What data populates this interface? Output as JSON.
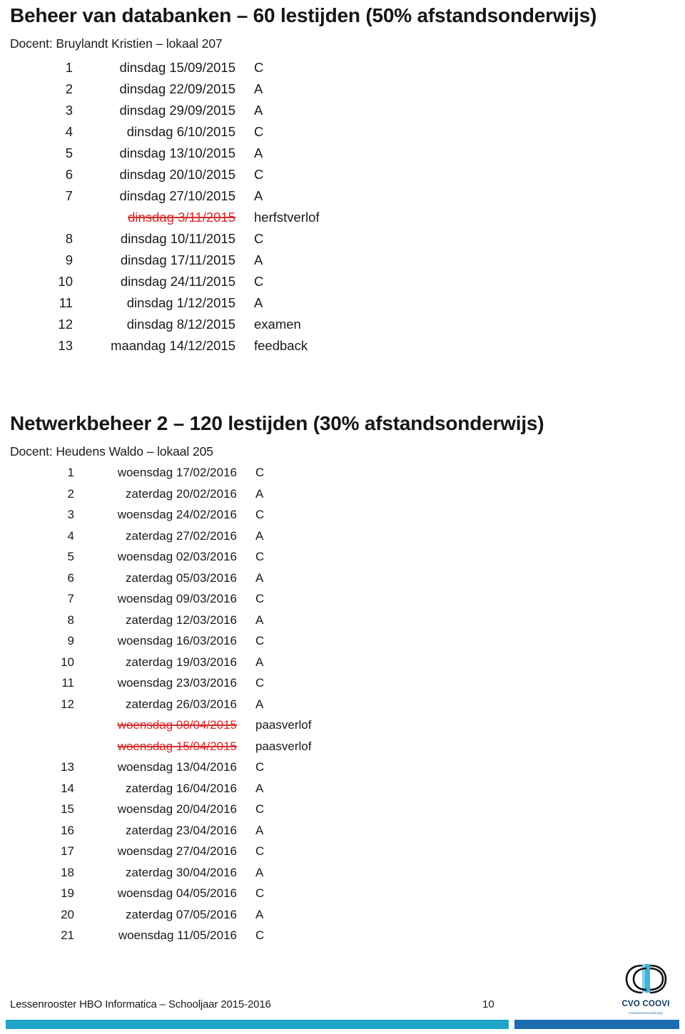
{
  "document": {
    "sections": [
      {
        "id": "section-1",
        "title": "Beheer van databanken – 60 lestijden (50% afstandsonderwijs)",
        "teacher": "Docent: Bruylandt Kristien – lokaal 207",
        "rows": [
          {
            "num": "1",
            "date": "dinsdag 15/09/2015",
            "code": "C",
            "cancelled": false
          },
          {
            "num": "2",
            "date": "dinsdag 22/09/2015",
            "code": "A",
            "cancelled": false
          },
          {
            "num": "3",
            "date": "dinsdag 29/09/2015",
            "code": "A",
            "cancelled": false
          },
          {
            "num": "4",
            "date": "dinsdag 6/10/2015",
            "code": "C",
            "cancelled": false
          },
          {
            "num": "5",
            "date": "dinsdag 13/10/2015",
            "code": "A",
            "cancelled": false
          },
          {
            "num": "6",
            "date": "dinsdag 20/10/2015",
            "code": "C",
            "cancelled": false
          },
          {
            "num": "7",
            "date": "dinsdag 27/10/2015",
            "code": "A",
            "cancelled": false
          },
          {
            "num": "",
            "date": "dinsdag 3/11/2015",
            "code": "herfstverlof",
            "cancelled": true
          },
          {
            "num": "8",
            "date": "dinsdag 10/11/2015",
            "code": "C",
            "cancelled": false
          },
          {
            "num": "9",
            "date": "dinsdag 17/11/2015",
            "code": "A",
            "cancelled": false
          },
          {
            "num": "10",
            "date": "dinsdag 24/11/2015",
            "code": "C",
            "cancelled": false
          },
          {
            "num": "11",
            "date": "dinsdag 1/12/2015",
            "code": "A",
            "cancelled": false
          },
          {
            "num": "12",
            "date": "dinsdag 8/12/2015",
            "code": "examen",
            "cancelled": false
          },
          {
            "num": "13",
            "date": "maandag 14/12/2015",
            "code": "feedback",
            "cancelled": false
          }
        ]
      },
      {
        "id": "section-2",
        "title": "Netwerkbeheer 2 – 120 lestijden (30% afstandsonderwijs)",
        "teacher": "Docent: Heudens Waldo – lokaal 205",
        "rows": [
          {
            "num": "1",
            "date": "woensdag 17/02/2016",
            "code": "C",
            "cancelled": false
          },
          {
            "num": "2",
            "date": "zaterdag 20/02/2016",
            "code": "A",
            "cancelled": false
          },
          {
            "num": "3",
            "date": "woensdag 24/02/2016",
            "code": "C",
            "cancelled": false
          },
          {
            "num": "4",
            "date": "zaterdag 27/02/2016",
            "code": "A",
            "cancelled": false
          },
          {
            "num": "5",
            "date": "woensdag 02/03/2016",
            "code": "C",
            "cancelled": false
          },
          {
            "num": "6",
            "date": "zaterdag 05/03/2016",
            "code": "A",
            "cancelled": false
          },
          {
            "num": "7",
            "date": "woensdag 09/03/2016",
            "code": "C",
            "cancelled": false
          },
          {
            "num": "8",
            "date": "zaterdag 12/03/2016",
            "code": "A",
            "cancelled": false
          },
          {
            "num": "9",
            "date": "woensdag 16/03/2016",
            "code": "C",
            "cancelled": false
          },
          {
            "num": "10",
            "date": "zaterdag 19/03/2016",
            "code": "A",
            "cancelled": false
          },
          {
            "num": "11",
            "date": "woensdag 23/03/2016",
            "code": "C",
            "cancelled": false
          },
          {
            "num": "12",
            "date": "zaterdag 26/03/2016",
            "code": "A",
            "cancelled": false
          },
          {
            "num": "",
            "date": "woensdag 08/04/2015",
            "code": "paasverlof",
            "cancelled": true
          },
          {
            "num": "",
            "date": "woensdag 15/04/2015",
            "code": "paasverlof",
            "cancelled": true
          },
          {
            "num": "13",
            "date": "woensdag 13/04/2016",
            "code": "C",
            "cancelled": false
          },
          {
            "num": "14",
            "date": "zaterdag 16/04/2016",
            "code": "A",
            "cancelled": false
          },
          {
            "num": "15",
            "date": "woensdag 20/04/2016",
            "code": "C",
            "cancelled": false
          },
          {
            "num": "16",
            "date": "zaterdag 23/04/2016",
            "code": "A",
            "cancelled": false
          },
          {
            "num": "17",
            "date": "woensdag 27/04/2016",
            "code": "C",
            "cancelled": false
          },
          {
            "num": "18",
            "date": "zaterdag 30/04/2016",
            "code": "A",
            "cancelled": false
          },
          {
            "num": "19",
            "date": "woensdag 04/05/2016",
            "code": "C",
            "cancelled": false
          },
          {
            "num": "20",
            "date": "zaterdag 07/05/2016",
            "code": "A",
            "cancelled": false
          },
          {
            "num": "21",
            "date": "woensdag 11/05/2016",
            "code": "C",
            "cancelled": false
          }
        ]
      }
    ]
  },
  "footer": {
    "label": "Lessenrooster HBO Informatica – Schooljaar 2015-2016",
    "page_number": "10",
    "logo_wordmark": "CVO COOVI",
    "logo_tagline": "volwassenenonderwijs",
    "bar_left_color": "#1FA4C8",
    "bar_right_color": "#1D6CB0"
  },
  "colors": {
    "cancelled_text": "#d92b2b",
    "body_text": "#1a1a1a",
    "accent_teal": "#1FA4C8",
    "accent_blue": "#1D6CB0"
  }
}
